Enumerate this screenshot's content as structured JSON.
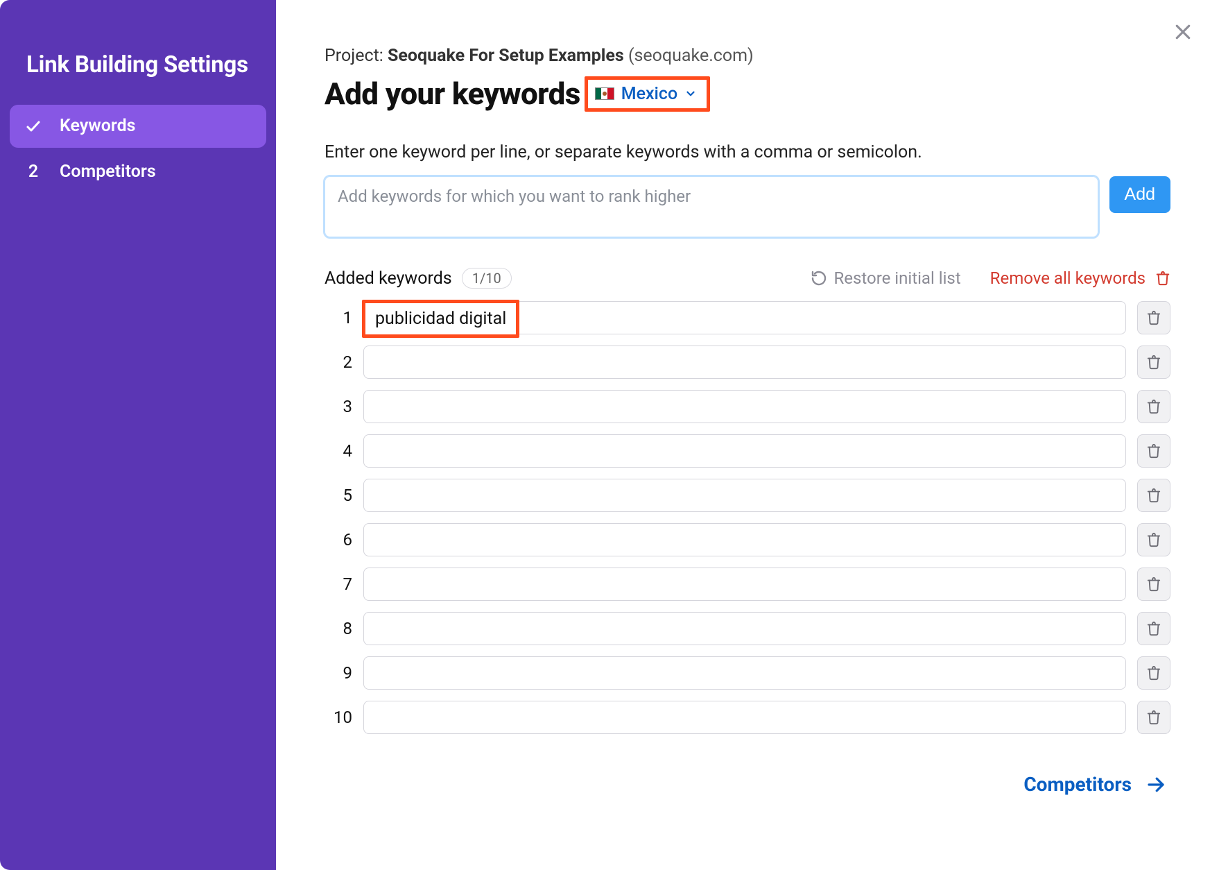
{
  "sidebar": {
    "title": "Link Building Settings",
    "items": [
      {
        "label": "Keywords",
        "lead_kind": "check",
        "active": true
      },
      {
        "label": "Competitors",
        "lead_kind": "number",
        "lead_value": "2",
        "active": false
      }
    ]
  },
  "project": {
    "prefix": "Project: ",
    "name": "Seoquake For Setup Examples",
    "domain": "(seoquake.com)"
  },
  "heading": "Add your keywords",
  "country": {
    "name": "Mexico"
  },
  "instruction": "Enter one keyword per line, or separate keywords with a comma or semicolon.",
  "add_input": {
    "placeholder": "Add keywords for which you want to rank higher",
    "value": ""
  },
  "add_button": "Add",
  "added": {
    "label": "Added keywords",
    "count": "1/10",
    "restore": "Restore initial list",
    "remove_all": "Remove all keywords"
  },
  "rows": [
    {
      "n": "1",
      "value": "publicidad digital",
      "highlight": true
    },
    {
      "n": "2",
      "value": ""
    },
    {
      "n": "3",
      "value": ""
    },
    {
      "n": "4",
      "value": ""
    },
    {
      "n": "5",
      "value": ""
    },
    {
      "n": "6",
      "value": ""
    },
    {
      "n": "7",
      "value": ""
    },
    {
      "n": "8",
      "value": ""
    },
    {
      "n": "9",
      "value": ""
    },
    {
      "n": "10",
      "value": ""
    }
  ],
  "footer": {
    "next": "Competitors"
  },
  "colors": {
    "sidebar_bg": "#5b36b4",
    "sidebar_active": "#8757e4",
    "link_blue": "#0a5ec2",
    "add_btn": "#2f97f3",
    "danger": "#d33b2f",
    "highlight_border": "#ff4b1d"
  }
}
